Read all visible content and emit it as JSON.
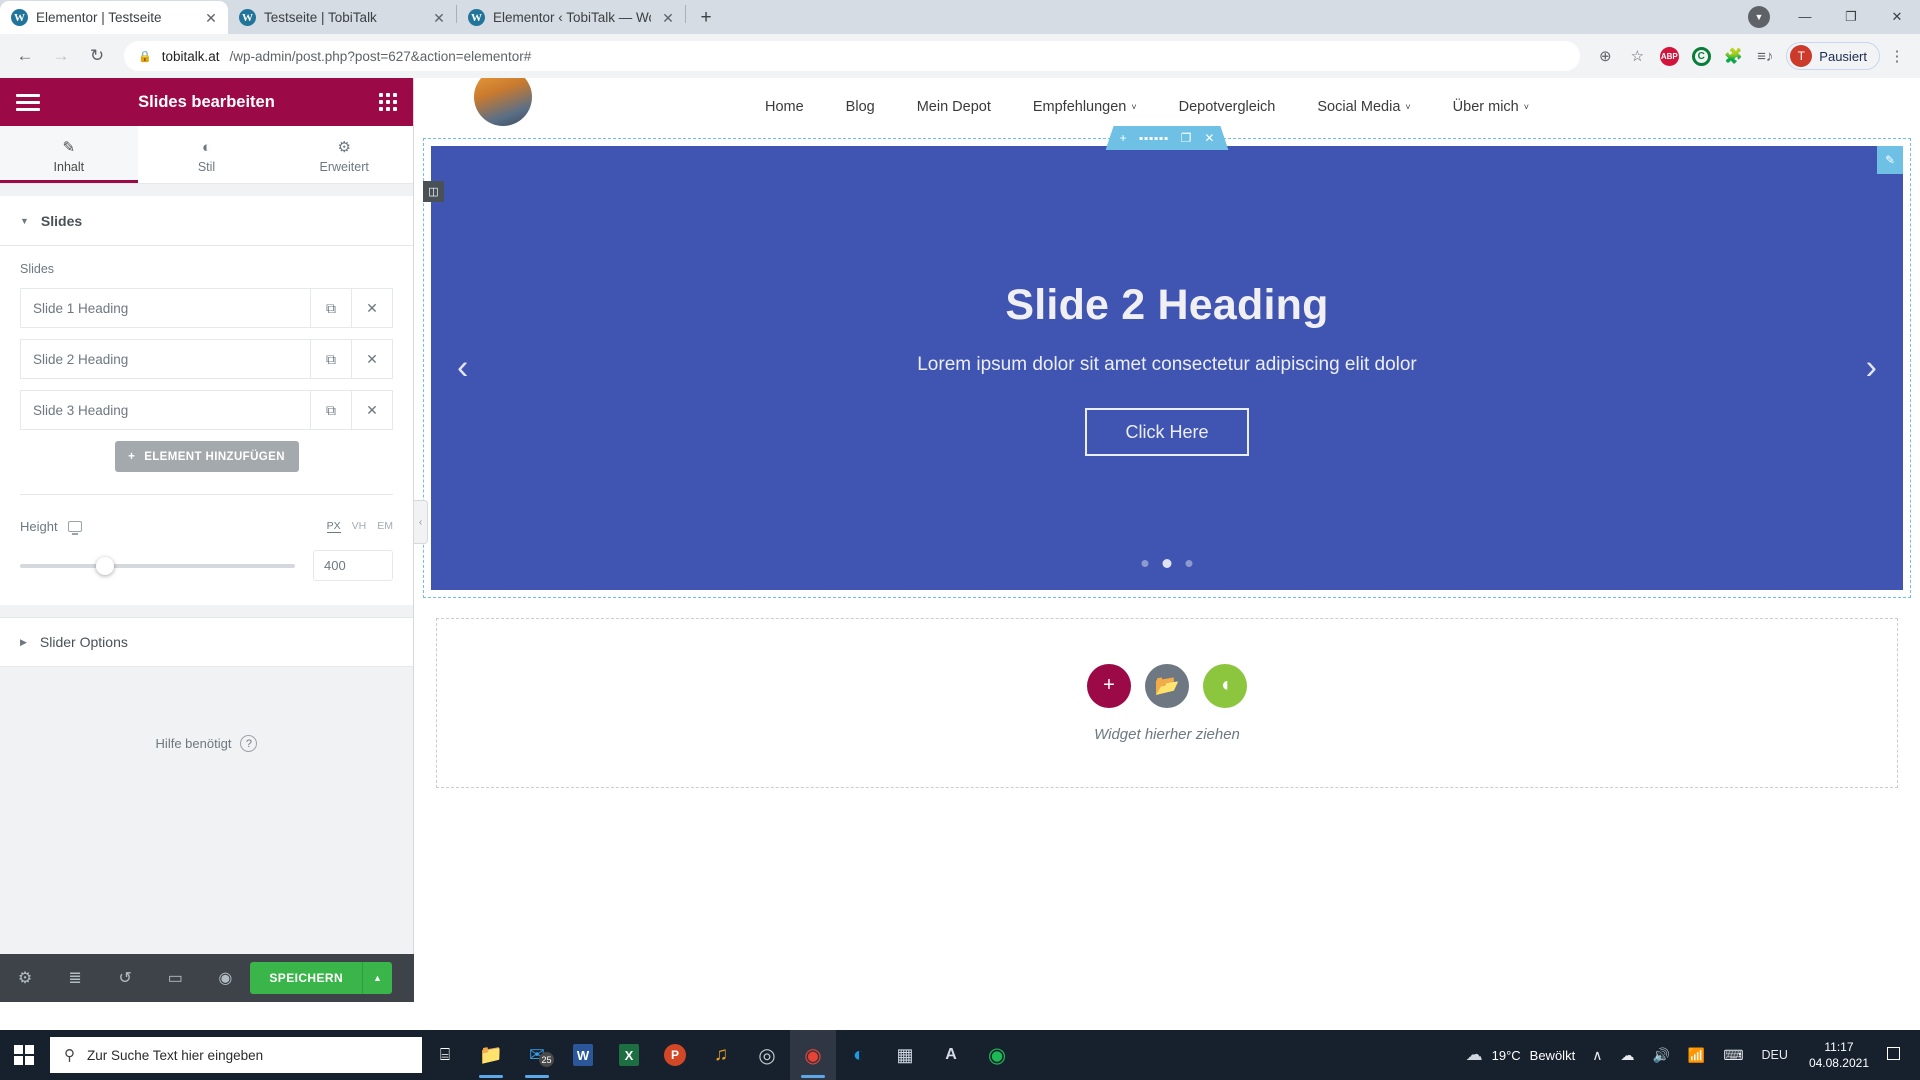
{
  "browser": {
    "tabs": [
      {
        "title": "Elementor | Testseite",
        "active": true,
        "close": "✕"
      },
      {
        "title": "Testseite | TobiTalk",
        "active": false,
        "close": "✕"
      },
      {
        "title": "Elementor ‹ TobiTalk — WordPre",
        "active": false,
        "close": "✕"
      }
    ],
    "new_tab_label": "+",
    "window_controls": {
      "minimize": "—",
      "maximize": "❐",
      "close": "✕",
      "download": "▼"
    },
    "nav": {
      "back": "←",
      "forward": "→",
      "reload": "↻"
    },
    "url_host": "tobitalk.at",
    "url_path": "/wp-admin/post.php?post=627&action=elementor#",
    "lock_icon": "🔒",
    "toolbar_icons": {
      "zoom": "⊕",
      "bookmark": "☆",
      "adblock": "ABP",
      "ghostery": "C",
      "extensions": "🧩",
      "readinglist": "≡♪",
      "menu": "⋮"
    },
    "profile": {
      "initial": "T",
      "label": "Pausiert"
    }
  },
  "panel": {
    "header": {
      "title": "Slides bearbeiten",
      "menu_icon": "hamburger-icon",
      "grid_icon": "widgets-grid-icon"
    },
    "tabs": [
      {
        "label": "Inhalt",
        "icon": "✎",
        "active": true
      },
      {
        "label": "Stil",
        "icon": "◐",
        "active": false
      },
      {
        "label": "Erweitert",
        "icon": "⚙",
        "active": false
      }
    ],
    "section_title": "Slides",
    "slides_field_label": "Slides",
    "slides": [
      {
        "title": "Slide 1 Heading",
        "duplicate": "⧉",
        "remove": "✕"
      },
      {
        "title": "Slide 2 Heading",
        "duplicate": "⧉",
        "remove": "✕"
      },
      {
        "title": "Slide 3 Heading",
        "duplicate": "⧉",
        "remove": "✕"
      }
    ],
    "add_item_label": "ELEMENT HINZUFÜGEN",
    "add_item_icon": "+",
    "height": {
      "label": "Height",
      "device_icon": "desktop-icon",
      "units": [
        "PX",
        "VH",
        "EM"
      ],
      "active_unit": "PX",
      "value": "400",
      "slider_percent": 31
    },
    "slider_options_label": "Slider Options",
    "help_label": "Hilfe benötigt",
    "help_icon": "?",
    "footer": {
      "icons": [
        {
          "name": "settings-icon",
          "glyph": "⚙"
        },
        {
          "name": "navigator-icon",
          "glyph": "≣"
        },
        {
          "name": "history-icon",
          "glyph": "↺"
        },
        {
          "name": "responsive-icon",
          "glyph": "▭"
        },
        {
          "name": "preview-icon",
          "glyph": "◉"
        }
      ],
      "save_label": "SPEICHERN",
      "save_arrow": "▲"
    },
    "collapse_handle": "‹"
  },
  "preview": {
    "site_nav": [
      {
        "label": "Home",
        "dropdown": false
      },
      {
        "label": "Blog",
        "dropdown": false
      },
      {
        "label": "Mein Depot",
        "dropdown": false
      },
      {
        "label": "Empfehlungen",
        "dropdown": true
      },
      {
        "label": "Depotvergleich",
        "dropdown": false
      },
      {
        "label": "Social Media",
        "dropdown": true
      },
      {
        "label": "Über mich",
        "dropdown": true
      }
    ],
    "dropdown_caret": "˅",
    "section_toolbar": {
      "add": "+",
      "drag": "drag-handle-icon",
      "duplicate": "❐",
      "remove": "✕"
    },
    "column_handle_icon": "column-icon",
    "edit_widget_icon": "✎",
    "slide": {
      "heading": "Slide 2 Heading",
      "paragraph": "Lorem ipsum dolor sit amet consectetur adipiscing elit dolor",
      "button": "Click Here",
      "arrow_prev": "‹",
      "arrow_next": "›",
      "background_color": "#4054b2",
      "dots_total": 3,
      "active_dot": 2
    },
    "dropzone": {
      "text": "Widget hierher ziehen",
      "buttons": [
        {
          "name": "add-section-button",
          "glyph": "+",
          "color": "#9b0a46"
        },
        {
          "name": "add-template-button",
          "glyph": "🗀",
          "color": "#6d7882"
        },
        {
          "name": "add-green-button",
          "glyph": "◖",
          "color": "#8cc63e"
        }
      ]
    }
  },
  "taskbar": {
    "search_placeholder": "Zur Suche Text hier eingeben",
    "search_icon": "⚲",
    "start_icon": "windows-logo-icon",
    "task_view_icon": "⌸",
    "apps": [
      {
        "name": "file-explorer-icon",
        "glyph": "🗀",
        "color": "#f2c14a"
      },
      {
        "name": "mail-icon",
        "glyph": "✉",
        "color": "#1b7fd4",
        "badge": "25"
      },
      {
        "name": "word-icon",
        "glyph": "W",
        "color": "#2b579a"
      },
      {
        "name": "excel-icon",
        "glyph": "X",
        "color": "#1d6f42"
      },
      {
        "name": "powerpoint-icon",
        "glyph": "P",
        "color": "#d24726"
      },
      {
        "name": "audacity-icon",
        "glyph": "◑",
        "color": "#e8b21d"
      },
      {
        "name": "obs-icon",
        "glyph": "◎",
        "color": "#9aa3ab"
      },
      {
        "name": "chrome-icon",
        "glyph": "◉",
        "color": "#4285f4",
        "active": true
      },
      {
        "name": "edge-icon",
        "glyph": "◔",
        "color": "#0f83c4"
      },
      {
        "name": "affinity-icon",
        "glyph": "◧",
        "color": "#c9d4e2"
      },
      {
        "name": "acrobat-icon",
        "glyph": "A",
        "color": "#cfd6df"
      },
      {
        "name": "spotify-icon",
        "glyph": "♫",
        "color": "#1db954"
      }
    ],
    "tray": {
      "weather_temp": "19°C",
      "weather_desc": "Bewölkt",
      "weather_icon": "☁",
      "expand": "∧",
      "onedrive": "☁",
      "volume": "🔊",
      "network": "📶",
      "keyboard": "⌨",
      "language": "DEU",
      "time": "11:17",
      "date": "04.08.2021",
      "notifications": "⬜"
    }
  }
}
